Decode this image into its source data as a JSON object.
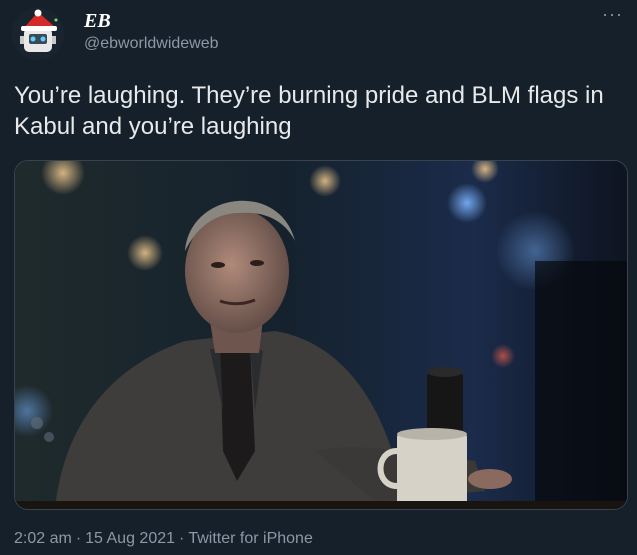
{
  "author": {
    "display_name": "EB",
    "handle": "@ebworldwideweb"
  },
  "icons": {
    "more": "more-options-icon",
    "avatar": "robot-santa-hat-avatar"
  },
  "tweet": {
    "text": "You’re laughing. They’re burning pride and BLM flags in Kabul and you’re laughing",
    "media_description": "man in suit at a dimly lit bar table with a mug"
  },
  "footer": {
    "time": "2:02 am",
    "date": "15 Aug 2021",
    "source": "Twitter for iPhone",
    "separator": "·"
  },
  "colors": {
    "background": "#15202b",
    "text_primary": "#e7e9ea",
    "text_secondary": "#8b98a5",
    "border": "#38444d"
  }
}
